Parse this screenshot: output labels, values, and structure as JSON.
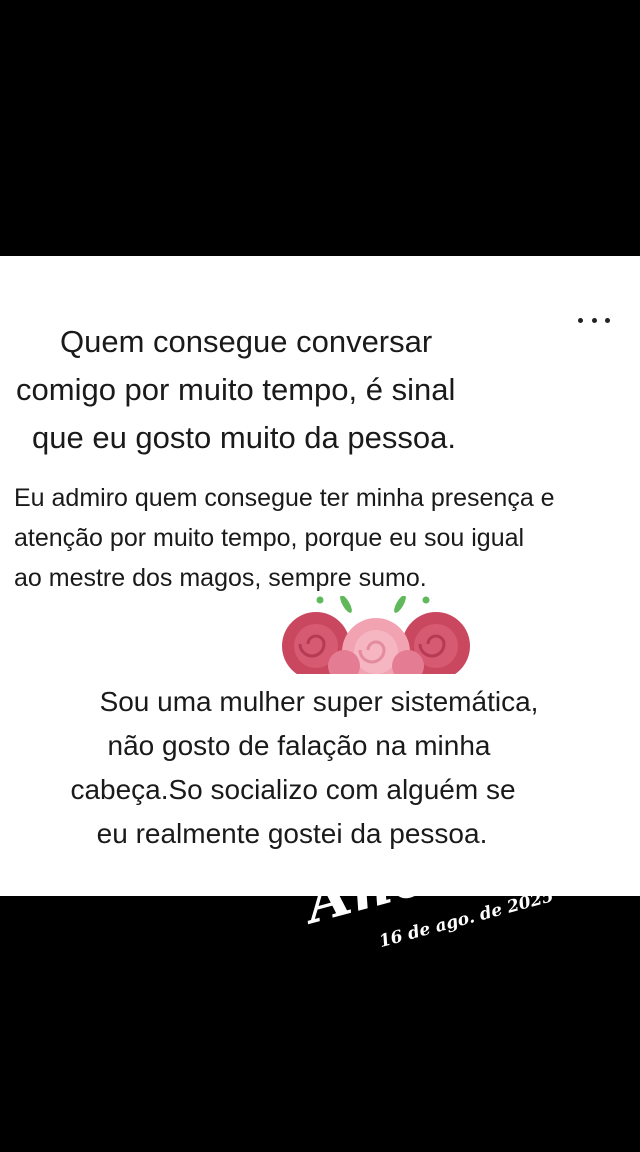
{
  "post": {
    "more_icon": "more-horizontal-icon",
    "quote1_lines": [
      "Quem consegue conversar",
      "comigo por muito tempo, é sinal",
      "que eu gosto muito da pessoa."
    ],
    "quote2_lines": [
      "Eu admiro quem consegue ter minha presença e",
      "atenção por muito tempo, porque eu sou igual",
      "ao mestre dos magos, sempre sumo."
    ],
    "decoration_icon": "roses-icon",
    "quote3_lines": [
      "Sou uma mulher super sistemática,",
      "não gosto de falação na minha",
      "cabeça.So socializo com alguém se",
      "eu realmente gostei da pessoa."
    ]
  },
  "memory_stamp": {
    "title": "Anos atrás",
    "date": "16 de ago. de 2025"
  },
  "colors": {
    "background": "#000000",
    "card": "#ffffff",
    "text": "#1a1a1a",
    "rose_dark": "#c9475f",
    "rose_light": "#f2a3b2",
    "leaf": "#5fb85a"
  }
}
